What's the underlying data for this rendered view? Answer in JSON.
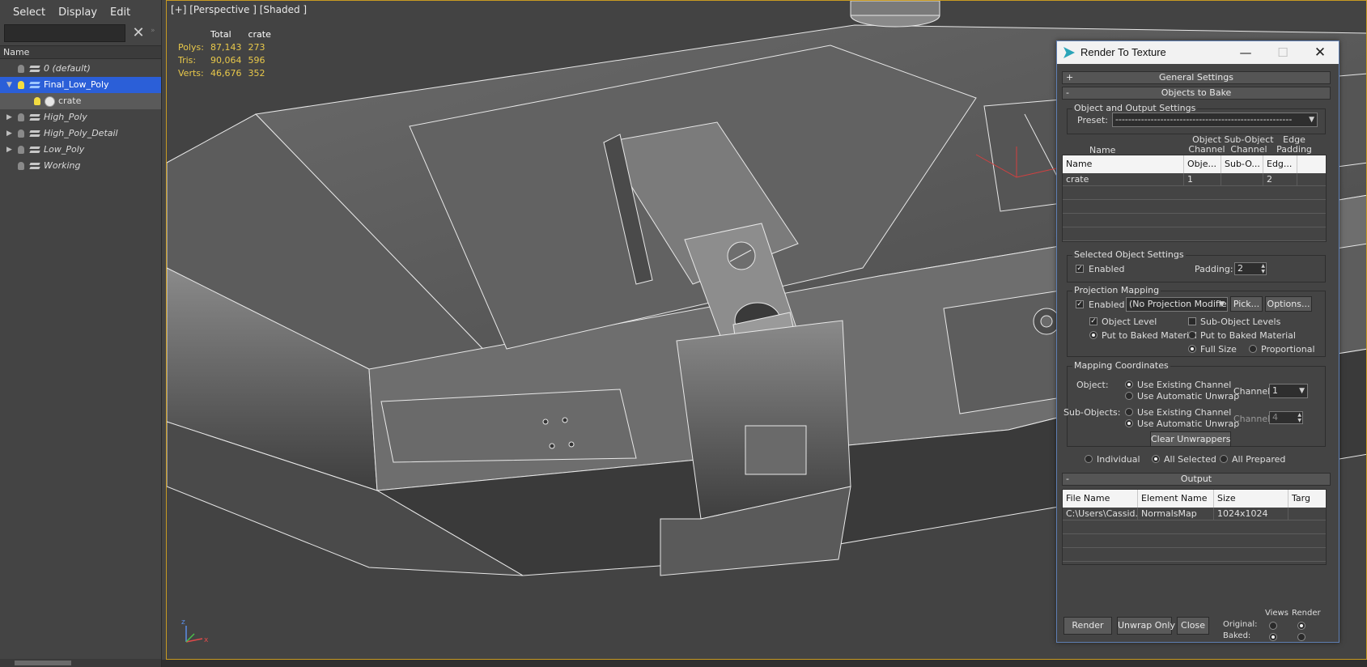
{
  "menubar": {
    "items": [
      "Select",
      "Display",
      "Edit"
    ]
  },
  "explorer": {
    "search": {
      "value": "",
      "placeholder": ""
    },
    "column_header": "Name",
    "tree": [
      {
        "label": "0 (default)",
        "bulb": "off",
        "selected": false,
        "child": false,
        "expander": ""
      },
      {
        "label": "Final_Low_Poly",
        "bulb": "on",
        "selected": true,
        "child": false,
        "expander": "▼"
      },
      {
        "label": "crate",
        "bulb": "on",
        "selected": false,
        "child": true,
        "expander": ""
      },
      {
        "label": "High_Poly",
        "bulb": "off",
        "selected": false,
        "child": false,
        "expander": "▶"
      },
      {
        "label": "High_Poly_Detail",
        "bulb": "off",
        "selected": false,
        "child": false,
        "expander": "▶"
      },
      {
        "label": "Low_Poly",
        "bulb": "off",
        "selected": false,
        "child": false,
        "expander": "▶"
      },
      {
        "label": "Working",
        "bulb": "off",
        "selected": false,
        "child": false,
        "expander": ""
      }
    ]
  },
  "viewport": {
    "label": "[+] [Perspective ] [Shaded ]",
    "stats": {
      "headers": [
        "",
        "Total",
        "crate"
      ],
      "rows": [
        {
          "name": "Polys:",
          "total": "87,143",
          "object": "273"
        },
        {
          "name": "Tris:",
          "total": "90,064",
          "object": "596"
        },
        {
          "name": "Verts:",
          "total": "46,676",
          "object": "352"
        }
      ]
    },
    "axis_labels": {
      "x": "x",
      "z": "z"
    }
  },
  "dialog": {
    "title": "Render To Texture",
    "rollouts": {
      "general": {
        "sign": "+",
        "label": "General Settings"
      },
      "objects": {
        "sign": "-",
        "label": "Objects to Bake"
      },
      "output": {
        "sign": "-",
        "label": "Output"
      }
    },
    "object_output": {
      "group_title": "Object and Output Settings",
      "preset_label": "Preset:",
      "preset_value": "-------------------------------------------------------"
    },
    "objects_table": {
      "col_labels": {
        "name": "Name",
        "object_channel": "Object\nChannel",
        "sub_object_channel": "Sub-Object\nChannel",
        "edge_padding": "Edge\nPadding"
      },
      "headers": [
        "Name",
        "Obje...",
        "Sub-O...",
        "Edg..."
      ],
      "rows": [
        {
          "name": "crate",
          "object_channel": "1",
          "sub_channel": "",
          "padding": "2"
        }
      ]
    },
    "selected_object": {
      "group_title": "Selected Object Settings",
      "enabled_label": "Enabled",
      "enabled": true,
      "padding_label": "Padding:",
      "padding_value": "2"
    },
    "projection": {
      "group_title": "Projection Mapping",
      "enabled_label": "Enabled",
      "enabled": true,
      "modifier": "(No Projection Modifier",
      "pick_label": "Pick...",
      "options_label": "Options...",
      "object_level_label": "Object Level",
      "object_level": true,
      "sub_object_levels_label": "Sub-Object Levels",
      "sub_object_levels": false,
      "put_baked_left": "Put to Baked Material",
      "put_baked_right": "Put to Baked Material",
      "full_size_label": "Full Size",
      "proportional_label": "Proportional"
    },
    "mapping": {
      "group_title": "Mapping Coordinates",
      "object_label": "Object:",
      "sub_objects_label": "Sub-Objects:",
      "use_existing": "Use Existing Channel",
      "use_automatic": "Use Automatic Unwrap",
      "channel_label": "Channel:",
      "object_channel": "1",
      "sub_channel": "4",
      "clear_label": "Clear Unwrappers"
    },
    "scope": {
      "individual": "Individual",
      "all_selected": "All Selected",
      "all_prepared": "All Prepared",
      "selected": "all_selected"
    },
    "output_table": {
      "headers": [
        "File Name",
        "Element Name",
        "Size",
        "Targ"
      ],
      "rows": [
        {
          "file": "C:\\Users\\Cassid...",
          "element": "NormalsMap",
          "size": "1024x1024",
          "target": ""
        }
      ]
    },
    "footer": {
      "render_label": "Render",
      "unwrap_label": "Unwrap Only",
      "close_label": "Close",
      "views_label": "Views",
      "render_col_label": "Render",
      "original_label": "Original:",
      "baked_label": "Baked:"
    }
  }
}
